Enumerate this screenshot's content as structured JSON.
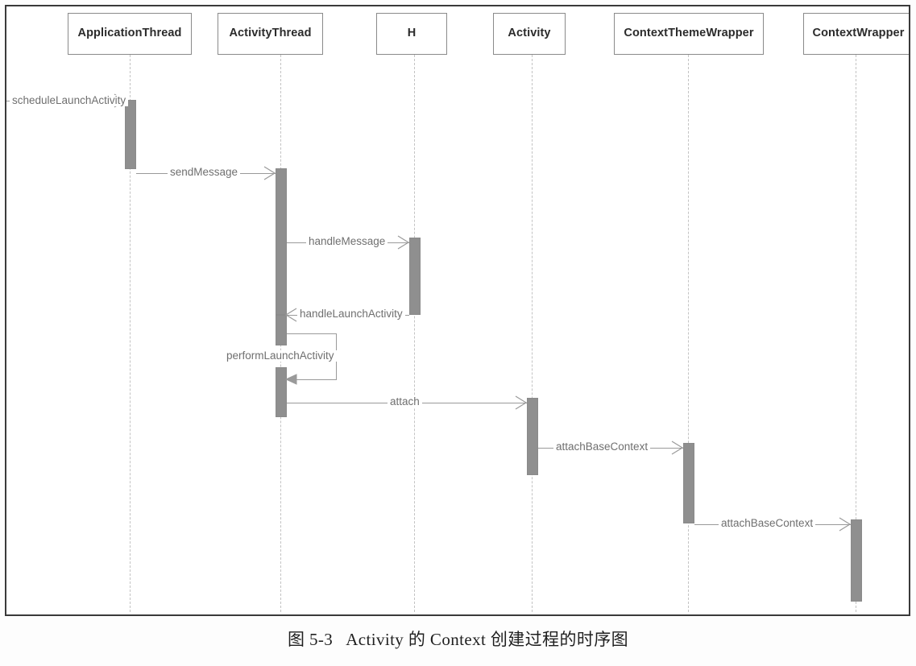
{
  "figure": {
    "caption_number": "图 5-3",
    "caption_text": "Activity 的 Context 创建过程的时序图"
  },
  "diagram": {
    "type": "uml-sequence-diagram",
    "lifelines": [
      {
        "id": "application-thread",
        "label": "ApplicationThread"
      },
      {
        "id": "activity-thread",
        "label": "ActivityThread"
      },
      {
        "id": "h",
        "label": "H"
      },
      {
        "id": "activity",
        "label": "Activity"
      },
      {
        "id": "context-theme-wrapper",
        "label": "ContextThemeWrapper"
      },
      {
        "id": "context-wrapper",
        "label": "ContextWrapper"
      }
    ],
    "messages": [
      {
        "id": "m1",
        "label": "scheduleLaunchActivity",
        "from": "found",
        "to": "application-thread",
        "direction": "right",
        "kind": "call"
      },
      {
        "id": "m2",
        "label": "sendMessage",
        "from": "application-thread",
        "to": "activity-thread",
        "direction": "right",
        "kind": "call"
      },
      {
        "id": "m3",
        "label": "handleMessage",
        "from": "activity-thread",
        "to": "h",
        "direction": "right",
        "kind": "call"
      },
      {
        "id": "m4",
        "label": "handleLaunchActivity",
        "from": "h",
        "to": "activity-thread",
        "direction": "left",
        "kind": "call"
      },
      {
        "id": "m5",
        "label": "performLaunchActivity",
        "from": "activity-thread",
        "to": "activity-thread",
        "direction": "self",
        "kind": "self-call"
      },
      {
        "id": "m6",
        "label": "attach",
        "from": "activity-thread",
        "to": "activity",
        "direction": "right",
        "kind": "call"
      },
      {
        "id": "m7",
        "label": "attachBaseContext",
        "from": "activity",
        "to": "context-theme-wrapper",
        "direction": "right",
        "kind": "call"
      },
      {
        "id": "m8",
        "label": "attachBaseContext",
        "from": "context-theme-wrapper",
        "to": "context-wrapper",
        "direction": "right",
        "kind": "call"
      }
    ],
    "colors": {
      "activation_fill": "#8f8f8f",
      "frame_border": "#3a3a3a",
      "lifeline_dash": "#c3c3c3",
      "message_line": "#9a9a9a",
      "label_text": "#6f6f6f",
      "head_text": "#2b2b2b",
      "background": "#ffffff"
    }
  }
}
